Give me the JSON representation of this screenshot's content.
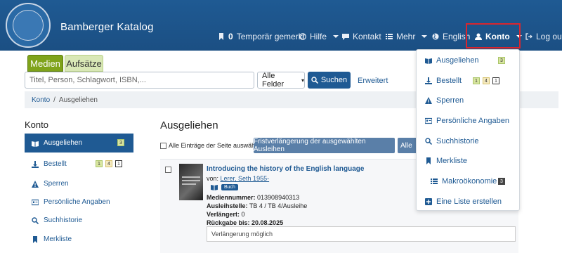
{
  "brand": "Bamberger Katalog",
  "topnav": {
    "bookmarks_count": "0",
    "bookmarks_label": "Temporär gemerkt",
    "help": "Hilfe",
    "contact": "Kontakt",
    "more": "Mehr",
    "language": "English",
    "account": "Konto",
    "logout": "Log out"
  },
  "search": {
    "tab_media": "Medien",
    "tab_articles": "Aufsätze",
    "placeholder": "Titel, Person, Schlagwort, ISBN,...",
    "field_select": "Alle Felder",
    "submit": "Suchen",
    "advanced": "Erweitert"
  },
  "breadcrumb": {
    "home": "Konto",
    "sep": "/",
    "current": "Ausgeliehen"
  },
  "sidebar": {
    "title": "Konto",
    "items": [
      {
        "label": "Ausgeliehen",
        "badges": [
          "3"
        ]
      },
      {
        "label": "Bestellt",
        "badges": [
          "1",
          "4",
          "1"
        ]
      },
      {
        "label": "Sperren"
      },
      {
        "label": "Persönliche Angaben"
      },
      {
        "label": "Suchhistorie"
      },
      {
        "label": "Merkliste"
      }
    ]
  },
  "main": {
    "title": "Ausgeliehen",
    "select_all": "Alle Einträge der Seite auswählen",
    "renew_selected": "Fristverlängerung der ausgewählten Ausleihen",
    "renew_all": "Alle"
  },
  "record": {
    "title": "Introducing the history of the English language",
    "author_prefix": "von:",
    "author": "Lerer, Seth 1955-",
    "format": "Buch",
    "medium_number_label": "Mediennummer:",
    "medium_number": "013908940313",
    "location_label": "Ausleihstelle:",
    "location": "TB 4 / TB 4/Ausleihe",
    "renewed_label": "Verlängert:",
    "renewed": "0",
    "due_label": "Rückgabe bis:",
    "due": "20.08.2025",
    "renew_status": "Verlängerung möglich"
  },
  "dropdown": {
    "items": [
      {
        "label": "Ausgeliehen",
        "badges": [
          "3"
        ]
      },
      {
        "label": "Bestellt",
        "badges": [
          "1",
          "4",
          "1"
        ]
      },
      {
        "label": "Sperren"
      },
      {
        "label": "Persönliche Angaben"
      },
      {
        "label": "Suchhistorie"
      },
      {
        "label": "Merkliste"
      },
      {
        "label": "Makroökonomie",
        "badges": [
          "3"
        ]
      },
      {
        "label": "Eine Liste erstellen"
      }
    ]
  },
  "colors": {
    "header": "#1f5a93",
    "accent_green": "#7fa31a",
    "highlight_red": "#d9262e"
  }
}
